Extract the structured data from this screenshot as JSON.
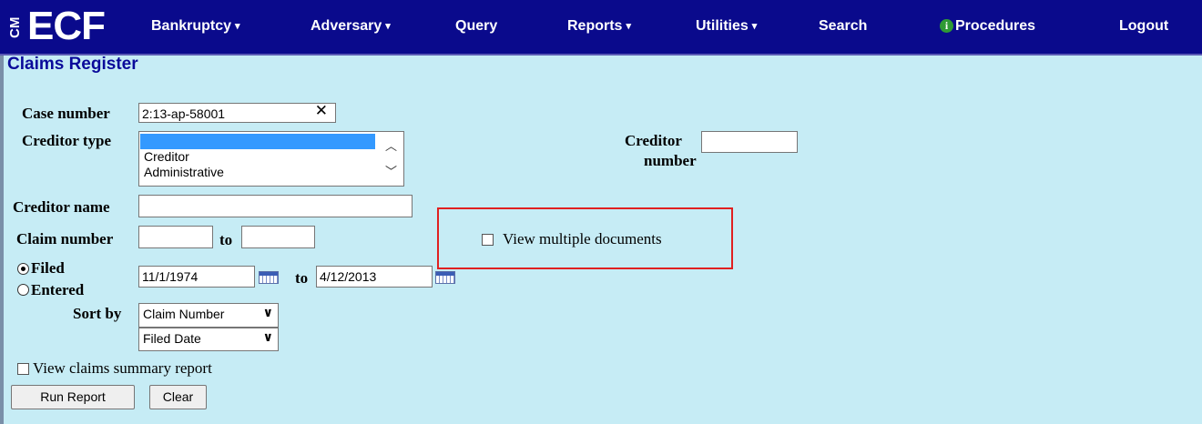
{
  "nav": {
    "logo_cm": "CM",
    "logo_ecf": "ECF",
    "items": [
      {
        "label": "Bankruptcy",
        "has_menu": true
      },
      {
        "label": "Adversary",
        "has_menu": true
      },
      {
        "label": "Query",
        "has_menu": false
      },
      {
        "label": "Reports",
        "has_menu": true
      },
      {
        "label": "Utilities",
        "has_menu": true
      },
      {
        "label": "Search",
        "has_menu": false
      },
      {
        "label": "Procedures",
        "has_menu": false
      },
      {
        "label": "Logout",
        "has_menu": false
      }
    ],
    "caret": "▾",
    "info_glyph": "i"
  },
  "page": {
    "title": "Claims Register"
  },
  "form": {
    "case_number": {
      "label": "Case number",
      "value": "2:13-ap-58001",
      "clear": "✕"
    },
    "creditor_type": {
      "label": "Creditor type",
      "options": [
        "",
        "Creditor",
        "Administrative"
      ],
      "selected_index": 0
    },
    "creditor_number": {
      "label_line1": "Creditor",
      "label_line2": "number",
      "value": ""
    },
    "creditor_name": {
      "label": "Creditor name",
      "value": ""
    },
    "claim_number": {
      "label": "Claim number",
      "from": "",
      "to_label": "to",
      "to": ""
    },
    "date_mode": {
      "options": [
        {
          "label": "Filed",
          "checked": true
        },
        {
          "label": "Entered",
          "checked": false
        }
      ]
    },
    "date_range": {
      "from": "11/1/1974",
      "to_label": "to",
      "to": "4/12/2013"
    },
    "view_multiple": {
      "label": "View multiple documents",
      "checked": false
    },
    "sort_by": {
      "label": "Sort by",
      "primary": "Claim Number",
      "secondary": "Filed Date"
    },
    "summary_report": {
      "label": "View claims summary report",
      "checked": false
    },
    "buttons": {
      "run": "Run Report",
      "clear": "Clear"
    }
  },
  "colors": {
    "nav_bg": "#0a0a8c",
    "page_bg": "#c6ecf5",
    "title": "#0a0a9a",
    "highlight": "#e02020",
    "selection": "#3399ff"
  }
}
